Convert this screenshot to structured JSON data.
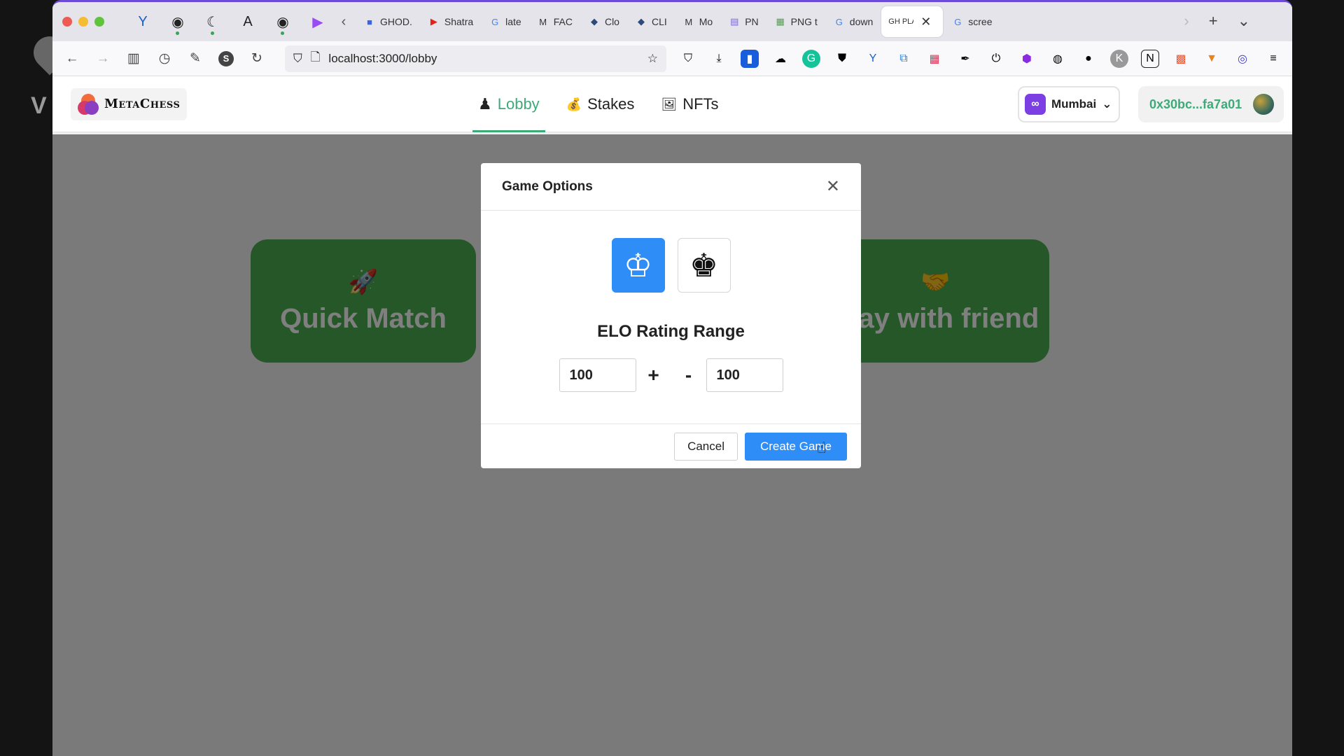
{
  "browser": {
    "pinned_tabs": [
      {
        "icon": "Y",
        "color": "#1a5fd1"
      },
      {
        "icon": "◉",
        "color": "#111111"
      },
      {
        "icon": "☾",
        "color": "#333333"
      },
      {
        "icon": "A",
        "color": "#222222"
      },
      {
        "icon": "◉",
        "color": "#111111"
      },
      {
        "icon": "▶",
        "color": "#9a4cf0"
      }
    ],
    "tabs": [
      {
        "label": "GHOD.",
        "icon": "■",
        "color": "#3b63e6"
      },
      {
        "label": "Shatra",
        "icon": "▶",
        "color": "#e62117"
      },
      {
        "label": "late",
        "icon": "G",
        "color": "#4285f4"
      },
      {
        "label": "FAC",
        "icon": "M",
        "color": "#111111"
      },
      {
        "label": "Clo",
        "icon": "◆",
        "color": "#2c4a7a"
      },
      {
        "label": "CLI",
        "icon": "◆",
        "color": "#2c4a7a"
      },
      {
        "label": "Mo",
        "icon": "M",
        "color": "#111111"
      },
      {
        "label": "PN",
        "icon": "▤",
        "color": "#7a6bd0"
      },
      {
        "label": "PNG t",
        "icon": "▦",
        "color": "#5a9a5a"
      },
      {
        "label": "down",
        "icon": "G",
        "color": "#4285f4"
      }
    ],
    "active_tab": {
      "label": "GH PLA"
    },
    "after_tab": {
      "label": "scree",
      "icon": "G",
      "color": "#4285f4"
    },
    "url": "localhost:3000/lobby"
  },
  "app": {
    "logo_text": "MetaChess",
    "nav": [
      {
        "label": "Lobby",
        "icon": "♟"
      },
      {
        "label": "Stakes",
        "icon": "💰"
      },
      {
        "label": "NFTs",
        "icon": "🖼"
      }
    ],
    "network": "Mumbai",
    "wallet": "0x30bc...fa7a01"
  },
  "lobby": {
    "quick_match": {
      "label": "Quick Match",
      "emoji": "🚀"
    },
    "play_friend": {
      "label": "Play with friend",
      "emoji": "🤝"
    }
  },
  "modal": {
    "title": "Game Options",
    "pieces": {
      "white": "♔",
      "black": "♚"
    },
    "selected_piece": "white",
    "elo_title": "ELO Rating Range",
    "elo_plus_value": "100",
    "elo_minus_value": "100",
    "plus_sign": "+",
    "minus_sign": "-",
    "cancel_label": "Cancel",
    "create_label": "Create Game"
  },
  "colors": {
    "accent_green": "#3cab78",
    "card_green": "#4caf50",
    "primary_blue": "#2e8df7"
  }
}
